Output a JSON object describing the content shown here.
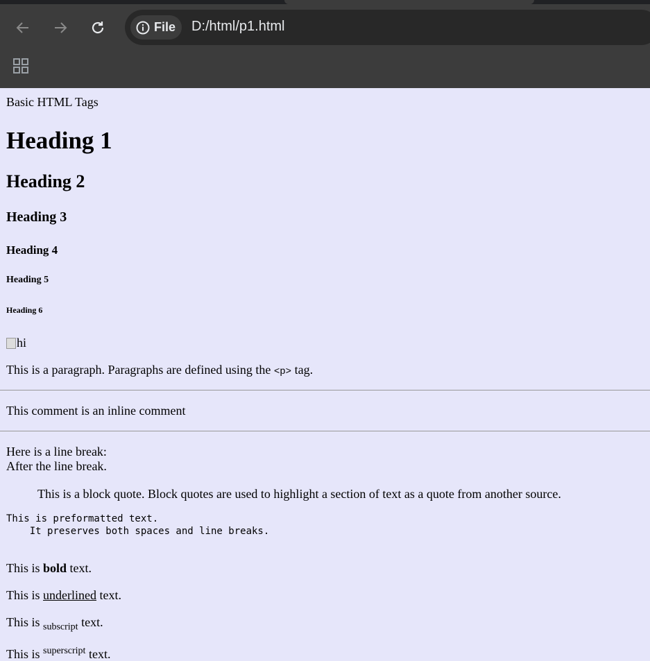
{
  "browser": {
    "chip_label": "File",
    "url": "D:/html/p1.html"
  },
  "page": {
    "text_title": "Basic HTML Tags",
    "h1": "Heading 1",
    "h2": "Heading 2",
    "h3": "Heading 3",
    "h4": "Heading 4",
    "h5": "Heading 5",
    "h6": "Heading 6",
    "image_alt": "hi",
    "paragraph_before": "This is a paragraph. Paragraphs are defined using the ",
    "paragraph_code": "<p>",
    "paragraph_after": " tag.",
    "comment_text": "This comment is an inline comment",
    "line_break_1": "Here is a line break:",
    "line_break_2": "After the line break.",
    "blockquote": "This is a block quote. Block quotes are used to highlight a section of text as a quote from another source.",
    "preformatted": "This is preformatted text.\n    It preserves both spaces and line breaks.",
    "bold_prefix": "This is ",
    "bold_word": "bold",
    "bold_suffix": " text.",
    "underline_prefix": "This is ",
    "underline_word": "underlined",
    "underline_suffix": " text.",
    "subscript_prefix": "This is ",
    "subscript_word": "subscript",
    "subscript_suffix": " text.",
    "superscript_prefix": "This is ",
    "superscript_word": "superscript",
    "superscript_suffix": " text."
  },
  "colors": {
    "page_background": "#e6e6fa",
    "toolbar": "#3c3c3c",
    "omnibox": "#282828"
  }
}
